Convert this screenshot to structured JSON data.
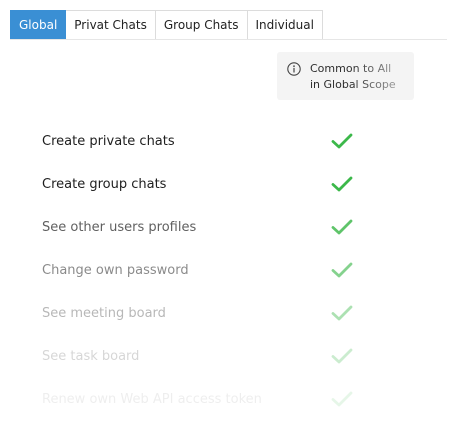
{
  "tabs": [
    {
      "label": "Global",
      "active": true
    },
    {
      "label": "Privat Chats",
      "active": false
    },
    {
      "label": "Group Chats",
      "active": false
    },
    {
      "label": "Individual",
      "active": false
    }
  ],
  "scope_badge": {
    "icon": "info-icon",
    "line1": "Common to All",
    "line2": "in Global Scope"
  },
  "permissions": [
    {
      "label": "Create private chats",
      "enabled": true
    },
    {
      "label": "Create group chats",
      "enabled": true
    },
    {
      "label": "See other users profiles",
      "enabled": true
    },
    {
      "label": "Change own password",
      "enabled": true
    },
    {
      "label": "See meeting board",
      "enabled": true
    },
    {
      "label": "See task board",
      "enabled": true
    },
    {
      "label": "Renew own Web API access token",
      "enabled": true
    }
  ],
  "colors": {
    "accent": "#3a8fd4",
    "check": "#3cb84a"
  }
}
